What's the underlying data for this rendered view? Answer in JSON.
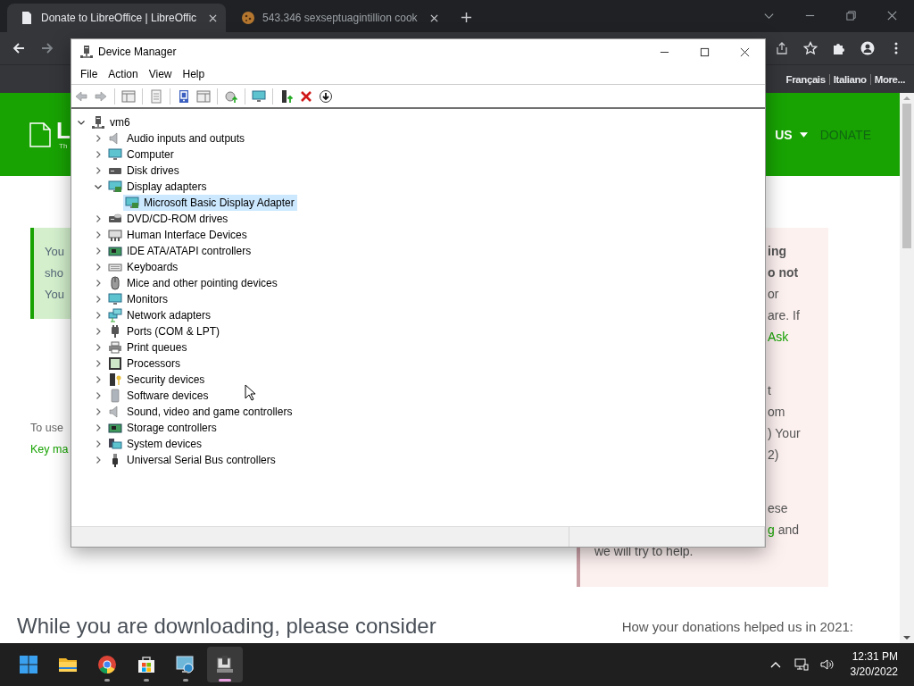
{
  "browser": {
    "tabs": [
      {
        "title": "Donate to LibreOffice | LibreOffic",
        "selected": true
      },
      {
        "title": "543.346 sexseptuagintillion cook",
        "selected": false
      }
    ],
    "bookmarks": [
      "Français",
      "Italiano",
      "More..."
    ]
  },
  "page": {
    "logo_letter": "L",
    "logo_tagline": "Th",
    "nav": [
      {
        "label": "US",
        "dropdown": true
      },
      {
        "label": "DONATE",
        "dropdown": false
      }
    ],
    "notice_left": [
      "You",
      "sho",
      "You"
    ],
    "left_text": "To use",
    "left_link": "Key ma",
    "notice_right": [
      {
        "lines": [
          {
            "text": "ing",
            "kind": "bold",
            "full": false
          },
          {
            "text": "o not",
            "kind": "bold",
            "full": false
          },
          {
            "text": "or",
            "kind": "plain",
            "full": false
          },
          {
            "text": "are. If",
            "kind": "plain",
            "full": false
          },
          {
            "text": "Ask",
            "kind": "link",
            "full": false
          }
        ]
      },
      {
        "lines": [
          {
            "text": "t",
            "kind": "plain",
            "full": false
          },
          {
            "text": "om",
            "kind": "plain",
            "full": false
          },
          {
            "text": ") Your",
            "kind": "plain",
            "full": false
          },
          {
            "text": "2)",
            "kind": "plain",
            "full": false
          }
        ]
      },
      {
        "lines": [
          {
            "text": "ese",
            "kind": "plain",
            "full": false
          },
          {
            "text": " and",
            "kind": "plain",
            "full": false,
            "link_before": "g"
          },
          {
            "text": "we will try to help.",
            "kind": "plain",
            "full": true
          }
        ]
      }
    ],
    "heading": "While you are downloading, please consider",
    "side_heading": "How your donations helped us in 2021:"
  },
  "device_manager": {
    "title": "Device Manager",
    "menu": [
      "File",
      "Action",
      "View",
      "Help"
    ],
    "tree": {
      "label": "vm6",
      "expanded": true,
      "selected": false,
      "children": [
        {
          "label": "Audio inputs and outputs",
          "expanded": false,
          "selected": false
        },
        {
          "label": "Computer",
          "expanded": false,
          "selected": false
        },
        {
          "label": "Disk drives",
          "expanded": false,
          "selected": false
        },
        {
          "label": "Display adapters",
          "expanded": true,
          "selected": false,
          "children": [
            {
              "label": "Microsoft Basic Display Adapter",
              "selected": true
            }
          ]
        },
        {
          "label": "DVD/CD-ROM drives",
          "expanded": false,
          "selected": false
        },
        {
          "label": "Human Interface Devices",
          "expanded": false,
          "selected": false
        },
        {
          "label": "IDE ATA/ATAPI controllers",
          "expanded": false,
          "selected": false
        },
        {
          "label": "Keyboards",
          "expanded": false,
          "selected": false
        },
        {
          "label": "Mice and other pointing devices",
          "expanded": false,
          "selected": false
        },
        {
          "label": "Monitors",
          "expanded": false,
          "selected": false
        },
        {
          "label": "Network adapters",
          "expanded": false,
          "selected": false
        },
        {
          "label": "Ports (COM & LPT)",
          "expanded": false,
          "selected": false
        },
        {
          "label": "Print queues",
          "expanded": false,
          "selected": false
        },
        {
          "label": "Processors",
          "expanded": false,
          "selected": false
        },
        {
          "label": "Security devices",
          "expanded": false,
          "selected": false
        },
        {
          "label": "Software devices",
          "expanded": false,
          "selected": false
        },
        {
          "label": "Sound, video and game controllers",
          "expanded": false,
          "selected": false
        },
        {
          "label": "Storage controllers",
          "expanded": false,
          "selected": false
        },
        {
          "label": "System devices",
          "expanded": false,
          "selected": false
        },
        {
          "label": "Universal Serial Bus controllers",
          "expanded": false,
          "selected": false
        }
      ]
    }
  },
  "taskbar": {
    "apps": [
      {
        "running": false,
        "active": false
      },
      {
        "running": false,
        "active": false
      },
      {
        "running": true,
        "active": false
      },
      {
        "running": true,
        "active": false
      },
      {
        "running": true,
        "active": false
      },
      {
        "running": true,
        "active": true
      }
    ],
    "time": "12:31 PM",
    "date": "3/20/2022"
  }
}
